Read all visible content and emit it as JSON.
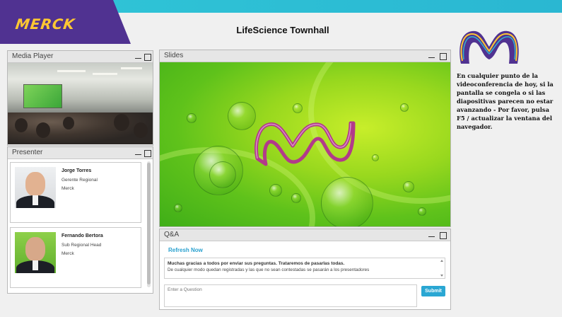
{
  "header": {
    "brand": "MERCK",
    "title": "LifeScience Townhall"
  },
  "media_player": {
    "title": "Media Player"
  },
  "presenter_panel": {
    "title": "Presenter",
    "presenters": [
      {
        "name": "Jorge Torres",
        "role": "Gerente Regional",
        "company": "Merck"
      },
      {
        "name": "Fernando Bertora",
        "role": "Sub Regional Head",
        "company": "Merck"
      }
    ]
  },
  "slides_panel": {
    "title": "Slides"
  },
  "qa_panel": {
    "title": "Q&A",
    "refresh_label": "Refresh Now",
    "answer_line1": "Muchas gracias a todos por enviar sus preguntas. Trataremos de pasarlas todas.",
    "answer_line2": "De cualquier modo quedan registradas y las que no sean contestadas se pasarán a los presentadores",
    "question_placeholder": "Enter a Question",
    "submit_label": "Submit"
  },
  "side_note": {
    "text": "En cualquier punto de la videoconferencia de hoy, si la pantalla se congela o si las diapositivas parecen no estar avanzando - Por favor, pulsa F5 / actualizar la ventana del navegador."
  },
  "colors": {
    "brand_purple": "#503291",
    "brand_yellow": "#ffc832",
    "banner_cyan": "#2fc3d6",
    "accent_blue": "#2aa7d3",
    "slide_green": "#98d81e"
  }
}
